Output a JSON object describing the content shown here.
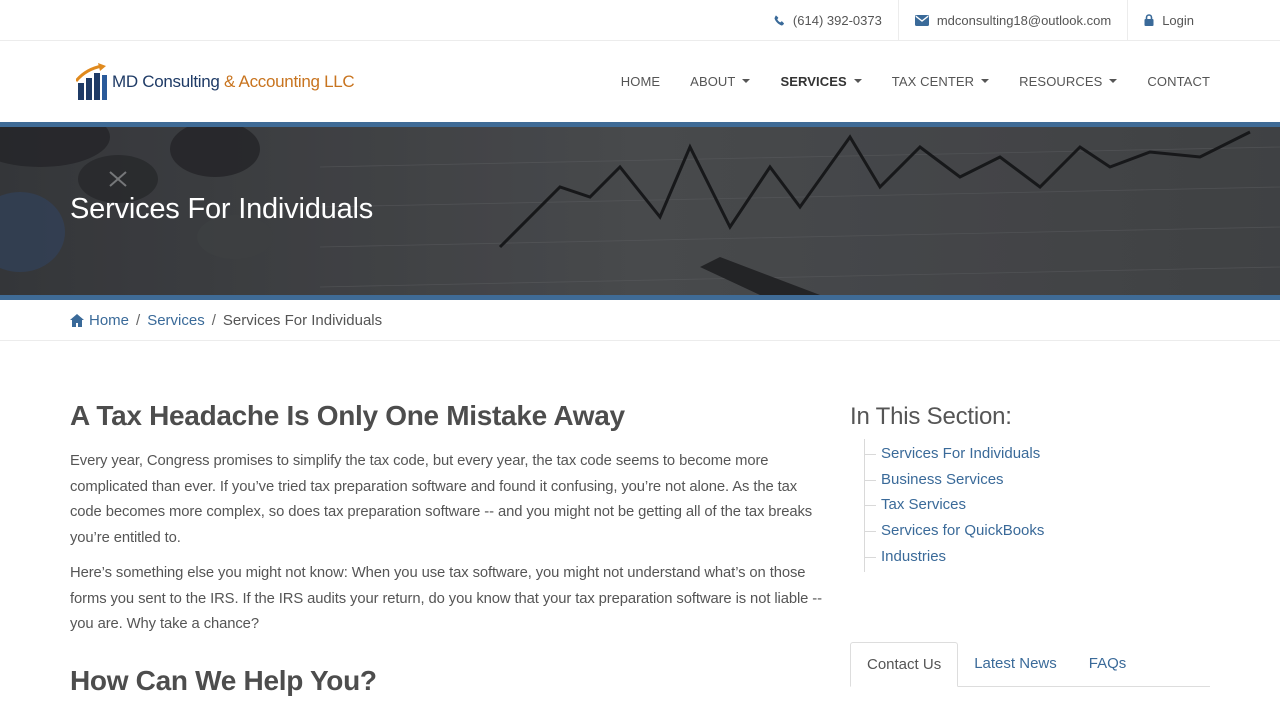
{
  "topbar": {
    "phone": "(614) 392-0373",
    "email": "mdconsulting18@outlook.com",
    "login": "Login"
  },
  "logo": {
    "part1": "MD Consulting",
    "part2": " & Accounting LLC"
  },
  "nav": {
    "home": "HOME",
    "about": "ABOUT",
    "services": "SERVICES",
    "tax_center": "TAX CENTER",
    "resources": "RESOURCES",
    "contact": "CONTACT"
  },
  "banner": {
    "title": "Services For Individuals"
  },
  "breadcrumb": {
    "home": "Home",
    "services": "Services",
    "current": "Services For Individuals",
    "separator": "/"
  },
  "main": {
    "heading1": "A Tax Headache Is Only One Mistake Away",
    "para1": "Every year, Congress promises to simplify the tax code, but every year, the tax code seems to become more complicated than ever. If you’ve tried tax preparation software and found it confusing, you’re not alone. As the tax code becomes more complex, so does tax preparation software -- and you might not be getting all of the tax breaks you’re entitled to.",
    "para2": "Here’s something else you might not know: When you use tax software, you might not understand what’s on those forms you sent to the IRS. If the IRS audits your return, do you know that your tax preparation software is not liable -- you are. Why take a chance?",
    "heading2": "How Can We Help You?"
  },
  "sidebar": {
    "title": "In This Section:",
    "items": [
      {
        "label": "Services For Individuals"
      },
      {
        "label": "Business Services"
      },
      {
        "label": "Tax Services"
      },
      {
        "label": "Services for QuickBooks"
      },
      {
        "label": "Industries"
      }
    ],
    "tabs": [
      {
        "label": "Contact Us",
        "active": true
      },
      {
        "label": "Latest News",
        "active": false
      },
      {
        "label": "FAQs",
        "active": false
      }
    ]
  },
  "colors": {
    "link": "#3a6a99",
    "banner_border": "#3f6b96",
    "logo_blue": "#1f3b66",
    "logo_orange": "#c8741f"
  }
}
